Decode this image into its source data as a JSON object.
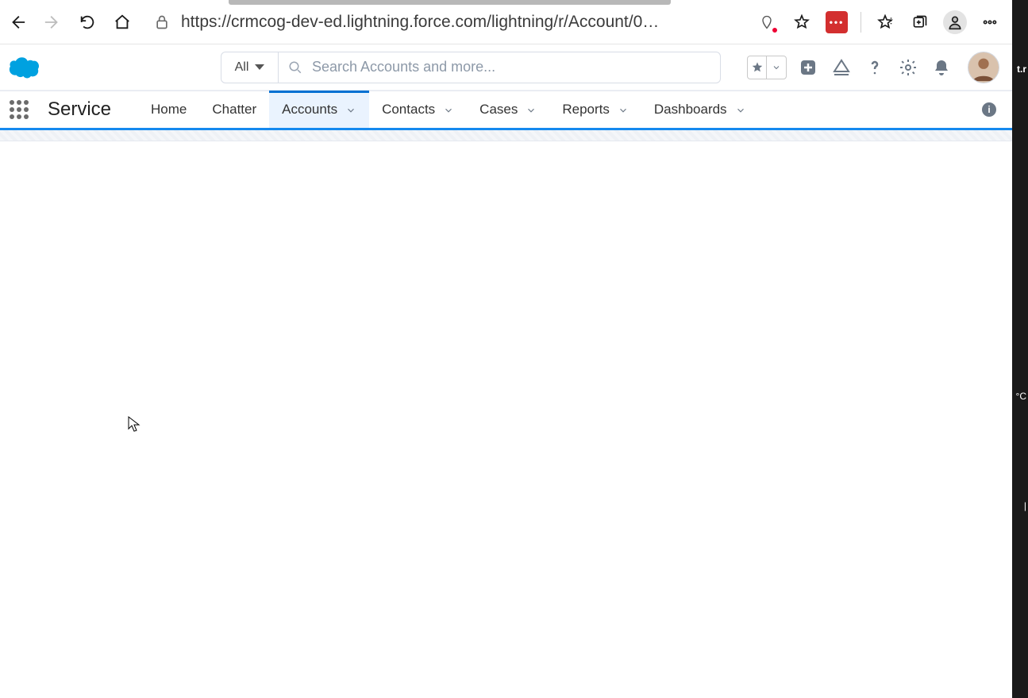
{
  "browser": {
    "url": "https://crmcog-dev-ed.lightning.force.com/lightning/r/Account/0…",
    "extension_label": "•••"
  },
  "header": {
    "search_scope": "All",
    "search_placeholder": "Search Accounts and more..."
  },
  "nav": {
    "app_name": "Service",
    "tabs": [
      {
        "label": "Home",
        "has_menu": false,
        "active": false
      },
      {
        "label": "Chatter",
        "has_menu": false,
        "active": false
      },
      {
        "label": "Accounts",
        "has_menu": true,
        "active": true
      },
      {
        "label": "Contacts",
        "has_menu": true,
        "active": false
      },
      {
        "label": "Cases",
        "has_menu": true,
        "active": false
      },
      {
        "label": "Reports",
        "has_menu": true,
        "active": false
      },
      {
        "label": "Dashboards",
        "has_menu": true,
        "active": false
      }
    ],
    "info_badge": "i"
  },
  "right_edge": {
    "peek1": "t.r",
    "peek2": "°C",
    "peek3": "|"
  }
}
